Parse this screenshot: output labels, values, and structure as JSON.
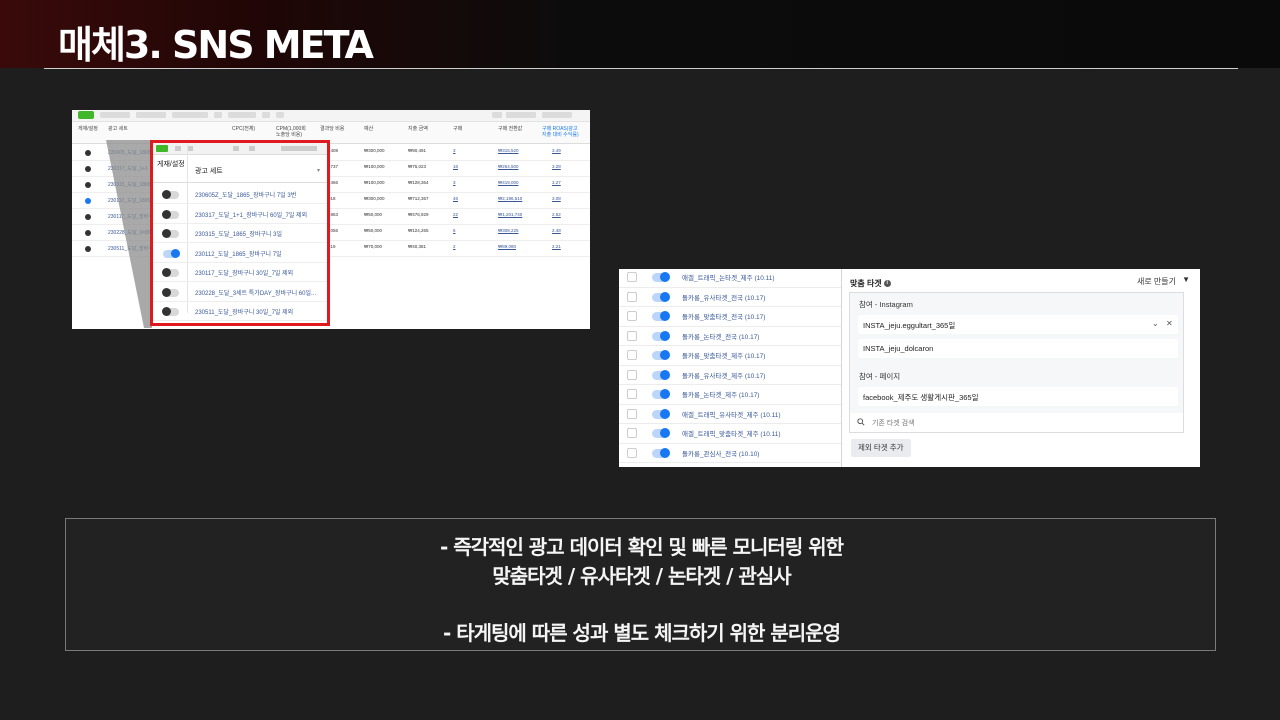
{
  "header": {
    "title": "매체3. SNS META"
  },
  "ads_table": {
    "columns": [
      "게재/설정",
      "광고 세트",
      "CPC(전체)",
      "CPM(1,000회 노출당 비용)",
      "결과당 비용",
      "예산",
      "지출 금액",
      "구매",
      "구매 전환값",
      "구매 ROAS(광고 지출 대비 수익률)"
    ],
    "rows": [
      {
        "name": "230605_도달_1865",
        "result_cost": "₩21,408",
        "budget": "₩300,000",
        "spent": "₩90,491",
        "purchases": "3",
        "conv_value": "₩315,520",
        "roas": "3.49"
      },
      {
        "name": "230317_도달_1+1",
        "result_cost": "₩25,737",
        "budget": "₩100,000",
        "spent": "₩75,023",
        "purchases": "16",
        "conv_value": "₩264,500",
        "roas": "3.28"
      },
      {
        "name": "230315_도달_1865",
        "result_cost": "₩71,466",
        "budget": "₩100,000",
        "spent": "₩128,364",
        "purchases": "3",
        "conv_value": "₩419,000",
        "roas": "3.27"
      },
      {
        "name": "230112_도달_1865",
        "result_cost": "₩8,018",
        "budget": "₩300,000",
        "spent": "₩712,367",
        "purchases": "46",
        "conv_value": "₩2,196,510",
        "roas": "3.08"
      },
      {
        "name": "230117_도달_장바구니",
        "result_cost": "₩34,863",
        "budget": "₩50,000",
        "spent": "₩476,929",
        "purchases": "22",
        "conv_value": "₩1,201,740",
        "roas": "2.52"
      },
      {
        "name": "230228_도달_3세트",
        "result_cost": "₩14,056",
        "budget": "₩50,000",
        "spent": "₩124,265",
        "purchases": "6",
        "conv_value": "₩308,225",
        "roas": "2.48"
      },
      {
        "name": "230511_도달_장바구니",
        "result_cost": "₩8,219",
        "budget": "₩70,000",
        "spent": "₩40,381",
        "purchases": "2",
        "conv_value": "₩89,080",
        "roas": "2.21"
      }
    ]
  },
  "zoom": {
    "col_status": "게재/설정",
    "col_name": "광고 세트",
    "rows": [
      {
        "label": "230605Z_도달_1865_장바구니 7일 3번",
        "on": false
      },
      {
        "label": "230317_도달_1+1_장바구니 60일_7일 제외",
        "on": false
      },
      {
        "label": "230315_도달_1865_장바구니 3일",
        "on": false
      },
      {
        "label": "230112_도달_1865_장바구니 7일",
        "on": true
      },
      {
        "label": "230117_도달_장바구니 30일_7일 제외",
        "on": false
      },
      {
        "label": "230228_도달_3세트 특가DAY_장바구니 60일...",
        "on": false
      },
      {
        "label": "230511_도달_장바구니 30일_7일 제외",
        "on": false
      }
    ]
  },
  "audience_list": {
    "items": [
      "애겔_트래픽_논타겟_제주 (10.11)",
      "돌카롱_유사타겟_전국 (10.17)",
      "돌카롱_맞춤타겟_전국 (10.17)",
      "돌카롱_논타겟_전국 (10.17)",
      "돌카롱_맞춤타겟_제주 (10.17)",
      "돌카롱_유사타겟_제주 (10.17)",
      "돌카롱_논타겟_제주 (10.17)",
      "애겔_트래픽_유사타겟_제주 (10.11)",
      "애겔_트래픽_맞춤타겟_제주 (10.11)",
      "돌카롱_관심사_전국 (10.10)"
    ]
  },
  "audience_panel": {
    "title": "맞춤 타겟",
    "new_label": "새로 만들기",
    "section_instagram": "참여 - Instagram",
    "instagram_1": "INSTA_jeju.eggultart_365일",
    "instagram_2": "INSTA_jeju_dolcaron",
    "section_page": "참여 - 페이지",
    "page_1": "facebook_제주도 생활게시판_365일",
    "search_placeholder": "기존 타겟 검색",
    "exclude_button": "제외 타겟 추가"
  },
  "summary": {
    "line1": "- 즉각적인 광고 데이터 확인 및 빠른 모니터링 위한",
    "line2": "맞춤타겟 / 유사타겟 / 논타겟 / 관심사",
    "line3": "- 타게팅에 따른 성과 별도 체크하기 위한  분리운영"
  },
  "colors": {
    "accent_red": "#e0191e",
    "fb_blue": "#1877f2",
    "link_blue": "#385898",
    "green": "#42b72a"
  }
}
